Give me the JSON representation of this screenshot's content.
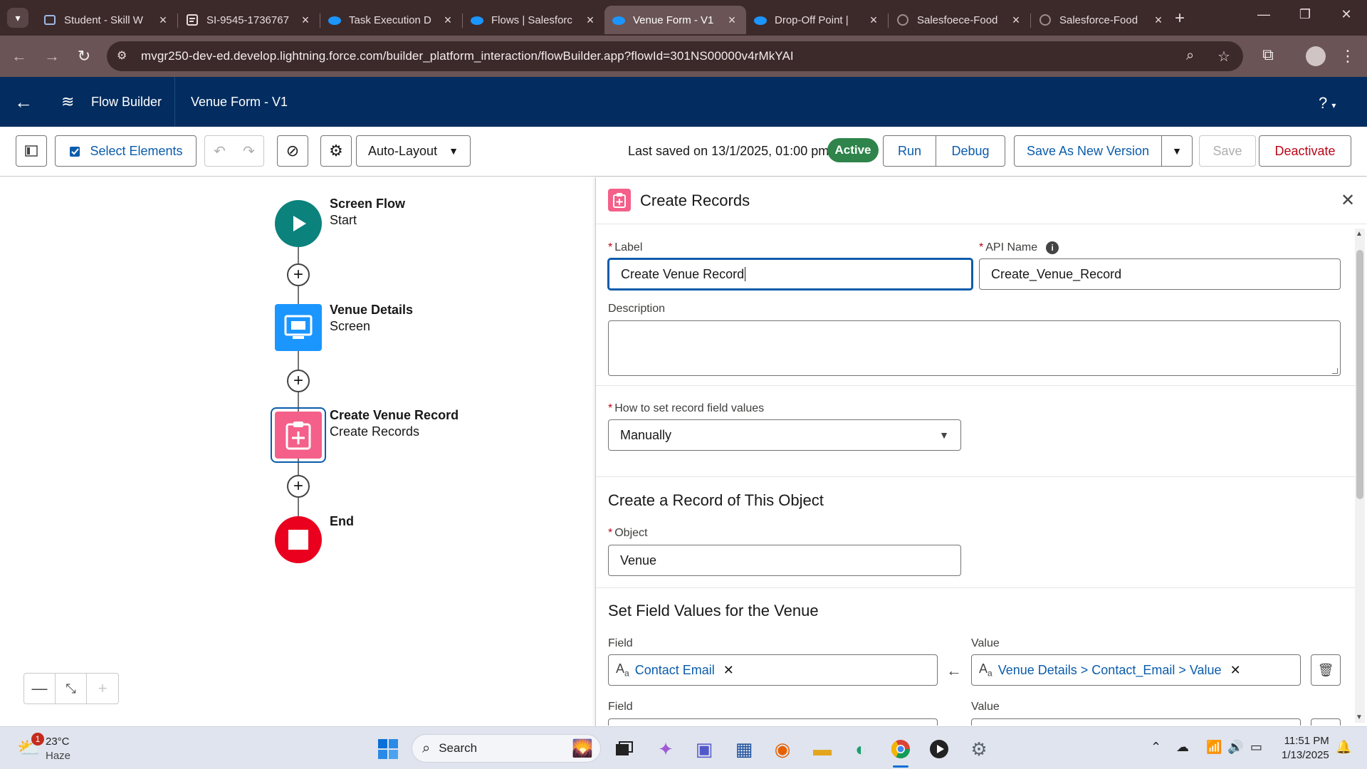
{
  "browser": {
    "tabs": [
      {
        "title": "Student - Skill W",
        "active": false
      },
      {
        "title": "SI-9545-1736767",
        "active": false
      },
      {
        "title": "Task Execution D",
        "active": false
      },
      {
        "title": "Flows | Salesforc",
        "active": false
      },
      {
        "title": "Venue Form - V1",
        "active": true
      },
      {
        "title": "Drop-Off Point |",
        "active": false
      },
      {
        "title": "Salesfoece-Food",
        "active": false
      },
      {
        "title": "Salesforce-Food",
        "active": false
      }
    ],
    "url": "mvgr250-dev-ed.develop.lightning.force.com/builder_platform_interaction/flowBuilder.app?flowId=301NS00000v4rMkYAI"
  },
  "app": {
    "name": "Flow Builder",
    "flow_name": "Venue Form - V1",
    "help": "?"
  },
  "toolbar": {
    "select_elements": "Select Elements",
    "layout": "Auto-Layout",
    "last_saved": "Last saved on 13/1/2025, 01:00 pm",
    "status": "Active",
    "run": "Run",
    "debug": "Debug",
    "save_as_new": "Save As New Version",
    "save": "Save",
    "deactivate": "Deactivate"
  },
  "canvas": {
    "nodes": [
      {
        "title": "Screen Flow",
        "subtitle": "Start",
        "icon": "play-icon",
        "color": "#0b827c"
      },
      {
        "title": "Venue Details",
        "subtitle": "Screen",
        "icon": "screen-icon",
        "color": "#1b96ff"
      },
      {
        "title": "Create Venue Record",
        "subtitle": "Create Records",
        "icon": "create-record-icon",
        "color": "#f4608a"
      },
      {
        "title": "End",
        "subtitle": "",
        "icon": "stop-icon",
        "color": "#ea001e"
      }
    ]
  },
  "panel": {
    "title": "Create Records",
    "label_label": "Label",
    "label_value": "Create Venue Record",
    "api_label": "API Name",
    "api_value": "Create_Venue_Record",
    "description_label": "Description",
    "description_value": "",
    "how_label": "How to set record field values",
    "how_value": "Manually",
    "object_section": "Create a Record of This Object",
    "object_label": "Object",
    "object_value": "Venue",
    "field_section": "Set Field Values for the Venue",
    "field_label": "Field",
    "value_label": "Value",
    "rows": [
      {
        "field": "Contact Email",
        "value": "Venue Details > Contact_Email > Value"
      }
    ]
  },
  "taskbar": {
    "temp": "23°C",
    "weather": "Haze",
    "notif_count": "1",
    "search": "Search",
    "time": "11:51 PM",
    "date": "1/13/2025"
  }
}
